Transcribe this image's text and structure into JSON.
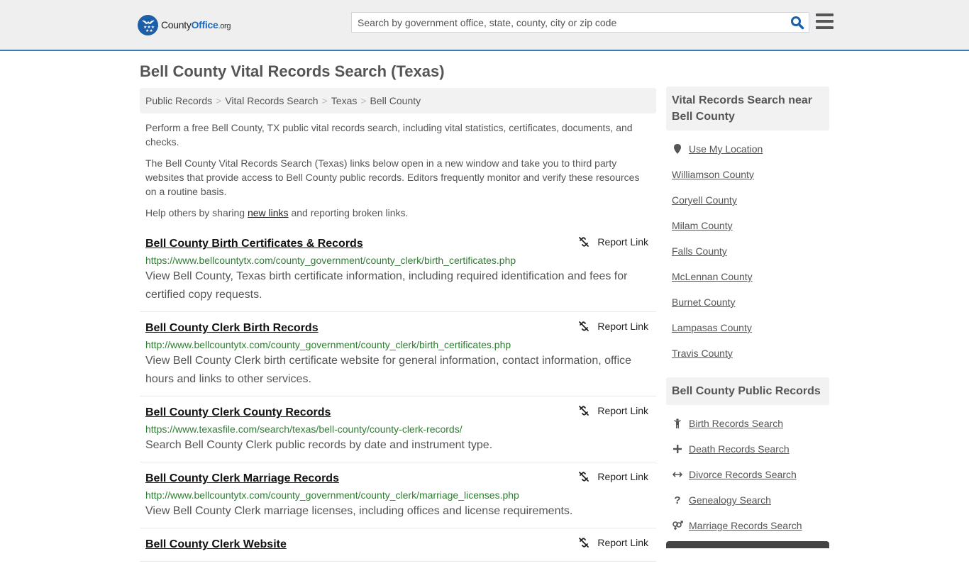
{
  "header": {
    "logo": {
      "county": "County",
      "office": "Office",
      "tld": ".org"
    },
    "search": {
      "placeholder": "Search by government office, state, county, city or zip code",
      "value": ""
    }
  },
  "page": {
    "title": "Bell County Vital Records Search (Texas)"
  },
  "breadcrumb": [
    {
      "label": "Public Records"
    },
    {
      "label": "Vital Records Search"
    },
    {
      "label": "Texas"
    },
    {
      "label": "Bell County"
    }
  ],
  "breadcrumb_separator": ">",
  "intro": {
    "p1": "Perform a free Bell County, TX public vital records search, including vital statistics, certificates, documents, and checks.",
    "p2": "The Bell County Vital Records Search (Texas) links below open in a new window and take you to third party websites that provide access to Bell County public records. Editors frequently monitor and verify these resources on a routine basis.",
    "p3_before": "Help others by sharing ",
    "p3_link": "new links",
    "p3_after": " and reporting broken links."
  },
  "report_label": "Report Link",
  "results": [
    {
      "title": "Bell County Birth Certificates & Records",
      "url": "https://www.bellcountytx.com/county_government/county_clerk/birth_certificates.php",
      "description": "View Bell County, Texas birth certificate information, including required identification and fees for certified copy requests."
    },
    {
      "title": "Bell County Clerk Birth Records",
      "url": "http://www.bellcountytx.com/county_government/county_clerk/birth_certificates.php",
      "description": "View Bell County Clerk birth certificate website for general information, contact information, office hours and links to other services."
    },
    {
      "title": "Bell County Clerk County Records",
      "url": "https://www.texasfile.com/search/texas/bell-county/county-clerk-records/",
      "description": "Search Bell County Clerk public records by date and instrument type."
    },
    {
      "title": "Bell County Clerk Marriage Records",
      "url": "http://www.bellcountytx.com/county_government/county_clerk/marriage_licenses.php",
      "description": "View Bell County Clerk marriage licenses, including offices and license requirements."
    },
    {
      "title": "Bell County Clerk Website",
      "url": "",
      "description": ""
    }
  ],
  "sidebar": {
    "nearby": {
      "title": "Vital Records Search near Bell County",
      "use_location": "Use My Location",
      "counties": [
        "Williamson County",
        "Coryell County",
        "Milam County",
        "Falls County",
        "McLennan County",
        "Burnet County",
        "Lampasas County",
        "Travis County"
      ]
    },
    "public_records": {
      "title": "Bell County Public Records",
      "items": [
        {
          "label": "Birth Records Search",
          "icon": "child-icon"
        },
        {
          "label": "Death Records Search",
          "icon": "plus-icon"
        },
        {
          "label": "Divorce Records Search",
          "icon": "arrows-horizontal-icon"
        },
        {
          "label": "Genealogy Search",
          "icon": "question-icon"
        },
        {
          "label": "Marriage Records Search",
          "icon": "marriage-symbol-icon"
        }
      ]
    }
  },
  "colors": {
    "brand_blue": "#1d6bbd",
    "header_border": "#3a7ab8",
    "url_green": "#2e7d32"
  }
}
